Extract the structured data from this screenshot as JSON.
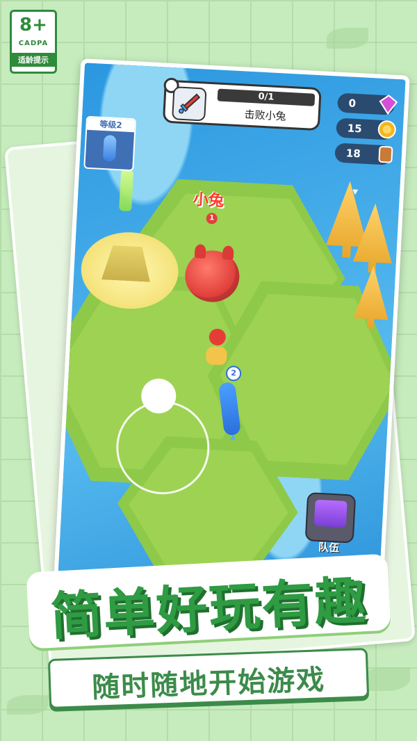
{
  "rating": {
    "age": "8+",
    "org": "CADPA",
    "tip": "适龄提示"
  },
  "quest": {
    "progress": "0/1",
    "task": "击败小兔"
  },
  "resources": [
    {
      "name": "gems",
      "value": "0",
      "icon": "gem-icon",
      "color": "#d64fd6"
    },
    {
      "name": "coins",
      "value": "15",
      "icon": "coin-icon",
      "color": "#f2b71e"
    },
    {
      "name": "wood",
      "value": "18",
      "icon": "wood-icon",
      "color": "#c97a36"
    }
  ],
  "player_level": {
    "label": "等级2"
  },
  "enemy": {
    "name": "小兔",
    "level": "1"
  },
  "ally": {
    "level": "2"
  },
  "team_button": {
    "label": "队伍"
  },
  "headline": {
    "title": "简单好玩有趣",
    "subtitle": "随时随地开始游戏"
  },
  "colors": {
    "accent": "#2f9b43",
    "dark_green": "#1f6f2e",
    "enemy_red": "#ff3b2a"
  }
}
